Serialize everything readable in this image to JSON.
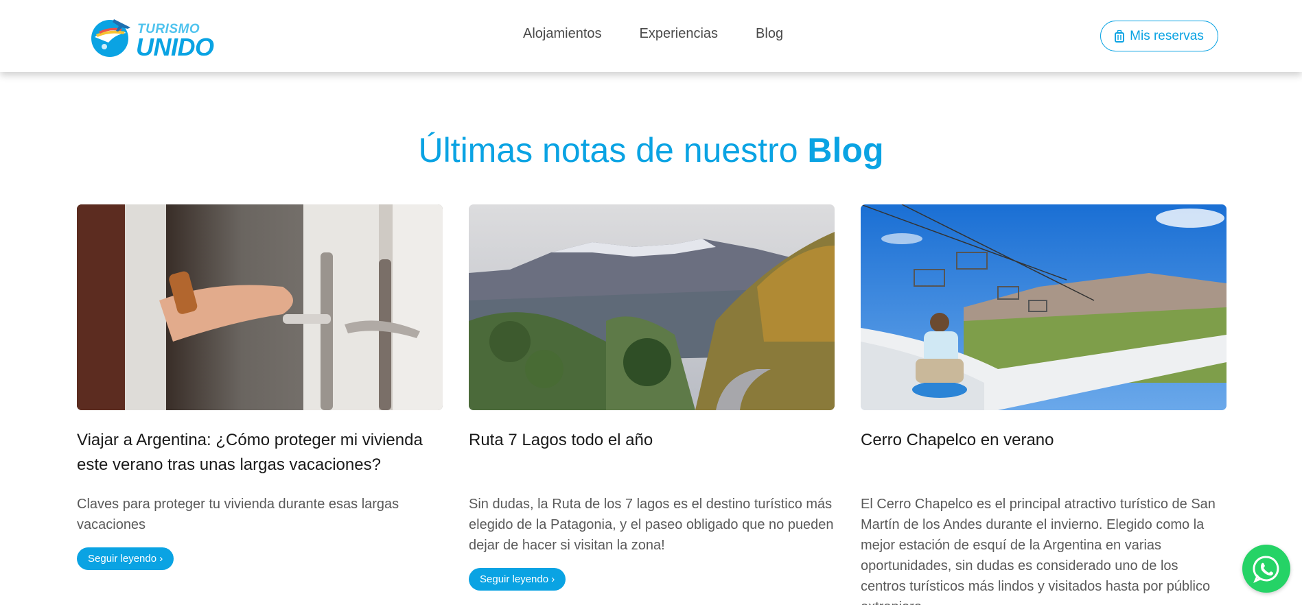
{
  "header": {
    "logo_top": "TURISMO",
    "logo_bottom": "UNIDO",
    "nav": [
      "Alojamientos",
      "Experiencias",
      "Blog"
    ],
    "reservations_label": "Mis reservas",
    "reservations_icon": "suitcase-icon"
  },
  "section": {
    "title_prefix": "Últimas notas de nuestro ",
    "title_highlight": "Blog"
  },
  "posts": [
    {
      "title": "Viajar a Argentina: ¿Cómo proteger mi vivienda este verano tras unas largas vacaciones?",
      "excerpt": "Claves para proteger tu vivienda durante esas largas vacaciones",
      "button": "Seguir leyendo ›",
      "image": "hand-opening-door-image"
    },
    {
      "title": "Ruta 7 Lagos todo el año",
      "excerpt": "Sin dudas, la Ruta de los 7 lagos es el destino turístico más elegido de la Patagonia, y el paseo obligado que no pueden dejar de hacer si visitan la zona!",
      "button": "Seguir leyendo ›",
      "image": "mountain-road-image"
    },
    {
      "title": "Cerro Chapelco en verano",
      "excerpt": "El Cerro Chapelco es el principal atractivo turístico de San Martín de los Andes durante el invierno. Elegido como la mejor estación de esquí de la Argentina en varias oportunidades, sin dudas es considerado uno de los centros turísticos más lindos y visitados hasta por público extranjero.",
      "button": "Seguir leyendo ›",
      "image": "alpine-slide-image"
    }
  ],
  "colors": {
    "accent": "#0aa3e3",
    "whatsapp": "#25d366"
  },
  "whatsapp_icon": "whatsapp-icon"
}
